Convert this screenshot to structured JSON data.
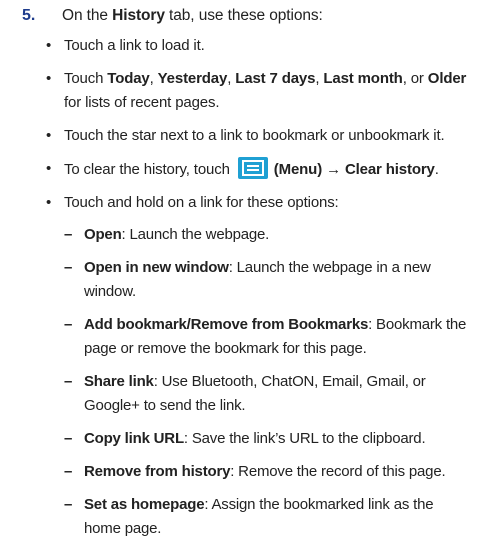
{
  "step": {
    "number": "5.",
    "prefix": "On the ",
    "tab": "History",
    "suffix": " tab, use these options:"
  },
  "bullets": [
    {
      "text": "Touch a link to load it."
    },
    {
      "prefix": "Touch ",
      "opt1": "Today",
      "sep1": ", ",
      "opt2": "Yesterday",
      "sep2": ", ",
      "opt3": "Last 7 days",
      "sep3": ", ",
      "opt4": "Last month",
      "sep4": ", or ",
      "opt5": "Older",
      "suffix": " for lists of recent pages."
    },
    {
      "text": "Touch the star next to a link to bookmark or unbookmark it."
    },
    {
      "prefix": "To clear the history, touch ",
      "icon": "menu-icon",
      "menu_label": "(Menu)",
      "arrow": "→",
      "action": "Clear history",
      "end": "."
    },
    {
      "text": "Touch and hold on a link for these options:"
    }
  ],
  "sub_options": [
    {
      "dash": "–",
      "term": "Open",
      "desc": ": Launch the webpage."
    },
    {
      "dash": "–",
      "term": "Open in new window",
      "desc": ": Launch the webpage in a new window."
    },
    {
      "dash": "–",
      "term": "Add bookmark/Remove from Bookmarks",
      "desc": ": Bookmark the page or remove the bookmark for this page."
    },
    {
      "dash": "–",
      "term": "Share link",
      "desc": ": Use Bluetooth, ChatON, Email, Gmail, or Google+ to send the link."
    },
    {
      "dash": "–",
      "term": "Copy link URL",
      "desc": ": Save the link’s URL to the clipboard."
    },
    {
      "dash": "–",
      "term": "Remove from history",
      "desc": ": Remove the record of this page."
    },
    {
      "dash": "–",
      "term": "Set as homepage",
      "desc": ": Assign the bookmarked link as the home page."
    }
  ],
  "colors": {
    "step_number": "#1e3c8c",
    "icon_bg": "#1fa0d3",
    "text": "#222222"
  }
}
